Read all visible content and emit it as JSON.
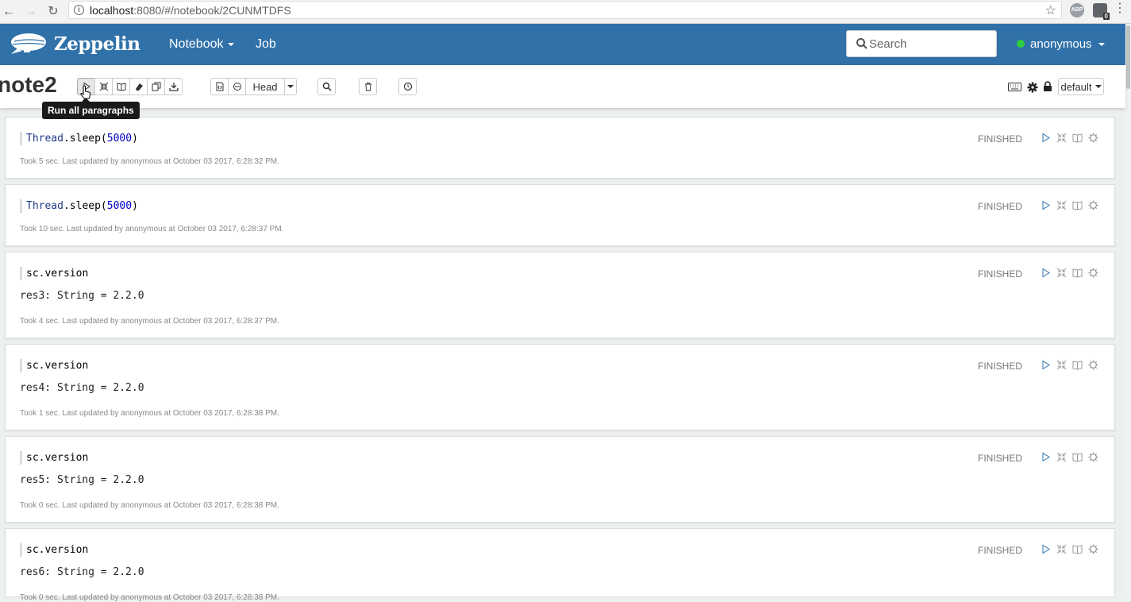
{
  "browser": {
    "url_host": "localhost",
    "url_path": ":8080/#/notebook/2CUNMTDFS",
    "abp_label": "ABP",
    "ext_badge": "0"
  },
  "header": {
    "brand": "Zeppelin",
    "menu_notebook": "Notebook",
    "menu_job": "Job",
    "search_placeholder": "Search",
    "user": "anonymous"
  },
  "note": {
    "title": "note2",
    "tooltip": "Run all paragraphs",
    "branch_label": "Head",
    "interpreter_label": "default"
  },
  "paragraphs": [
    {
      "code_obj": "Thread",
      "code_fn": ".sleep(",
      "code_num": "5000",
      "code_end": ")",
      "result": "",
      "footer": "Took 5 sec. Last updated by anonymous at October 03 2017, 6:28:32 PM.",
      "status": "FINISHED"
    },
    {
      "code_obj": "Thread",
      "code_fn": ".sleep(",
      "code_num": "5000",
      "code_end": ")",
      "result": "",
      "footer": "Took 10 sec. Last updated by anonymous at October 03 2017, 6:28:37 PM.",
      "status": "FINISHED"
    },
    {
      "code": "sc.version",
      "result": "res3: String = 2.2.0",
      "footer": "Took 4 sec. Last updated by anonymous at October 03 2017, 6:28:37 PM.",
      "status": "FINISHED"
    },
    {
      "code": "sc.version",
      "result": "res4: String = 2.2.0",
      "footer": "Took 1 sec. Last updated by anonymous at October 03 2017, 6:28:38 PM.",
      "status": "FINISHED"
    },
    {
      "code": "sc.version",
      "result": "res5: String = 2.2.0",
      "footer": "Took 0 sec. Last updated by anonymous at October 03 2017, 6:28:38 PM.",
      "status": "FINISHED"
    },
    {
      "code": "sc.version",
      "result": "res6: String = 2.2.0",
      "footer": "Took 0 sec. Last updated by anonymous at October 03 2017, 6:28:38 PM.",
      "status": "FINISHED"
    }
  ],
  "colors": {
    "header_bg": "#3071a9",
    "page_bg": "#ecf0f1",
    "status_dot": "#2ecc40"
  }
}
